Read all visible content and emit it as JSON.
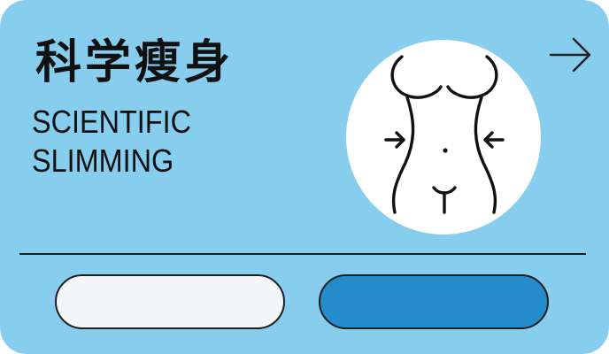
{
  "card": {
    "title_zh": "科学瘦身",
    "title_en_line1": "SCIENTIFIC",
    "title_en_line2": "SLIMMING",
    "background_color": "#87cdee",
    "arrow_icon": "arrow-right-icon",
    "illustration_icon": "body-waist-slimming-icon"
  },
  "buttons": {
    "left_color": "#f4f5f9",
    "right_color": "#258ccc"
  }
}
